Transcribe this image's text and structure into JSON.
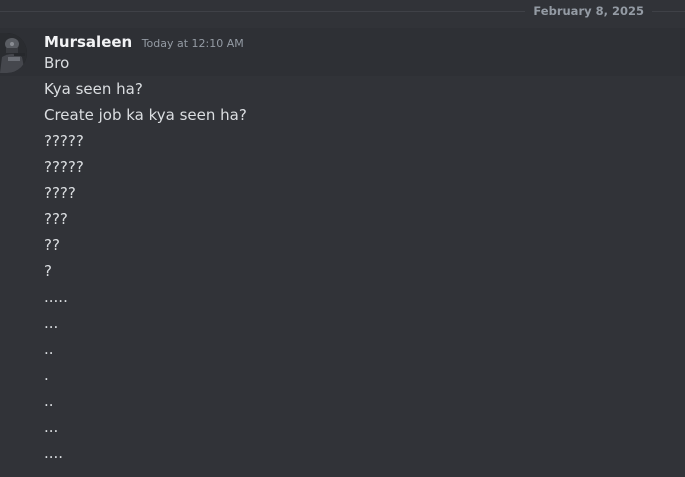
{
  "divider": {
    "date": "February 8, 2025"
  },
  "message_group": {
    "author": "Mursaleen",
    "timestamp": "Today at 12:10 AM",
    "avatar_icon": "soldier-avatar-icon",
    "messages": [
      "Bro",
      "Kya seen ha?",
      "Create job ka kya seen ha?",
      "?????",
      "?????",
      "????",
      "???",
      "??",
      "?",
      ".....",
      "...",
      "..",
      ".",
      "..",
      "...",
      "...."
    ]
  },
  "colors": {
    "background": "#313338",
    "hover_background": "#2e3035",
    "author": "#f2f3f5",
    "text": "#dbdee1",
    "muted": "#949ba4"
  }
}
